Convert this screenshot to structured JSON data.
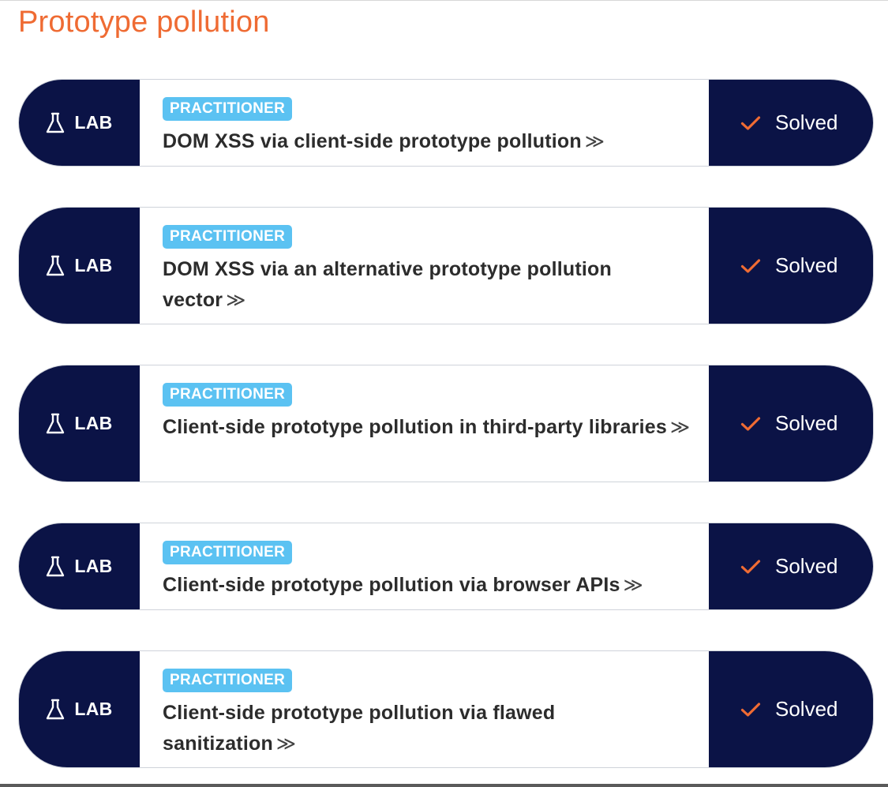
{
  "section": {
    "title": "Prototype pollution"
  },
  "colors": {
    "accent": "#ef6b33",
    "navy": "#0b1346",
    "level_blue": "#5bc2f2"
  },
  "labs": [
    {
      "type_label": "LAB",
      "type_icon": "flask-icon",
      "level": "PRACTITIONER",
      "title": "DOM XSS via client-side prototype pollution",
      "link_icon": "double-chevron-right-icon",
      "status_icon": "check-icon",
      "status": "Solved"
    },
    {
      "type_label": "LAB",
      "type_icon": "flask-icon",
      "level": "PRACTITIONER",
      "title": "DOM XSS via an alternative prototype pollution vector",
      "link_icon": "double-chevron-right-icon",
      "status_icon": "check-icon",
      "status": "Solved"
    },
    {
      "type_label": "LAB",
      "type_icon": "flask-icon",
      "level": "PRACTITIONER",
      "title": "Client-side prototype pollution in third-party libraries",
      "link_icon": "double-chevron-right-icon",
      "status_icon": "check-icon",
      "status": "Solved"
    },
    {
      "type_label": "LAB",
      "type_icon": "flask-icon",
      "level": "PRACTITIONER",
      "title": "Client-side prototype pollution via browser APIs",
      "link_icon": "double-chevron-right-icon",
      "status_icon": "check-icon",
      "status": "Solved"
    },
    {
      "type_label": "LAB",
      "type_icon": "flask-icon",
      "level": "PRACTITIONER",
      "title": "Client-side prototype pollution via flawed sanitization",
      "link_icon": "double-chevron-right-icon",
      "status_icon": "check-icon",
      "status": "Solved"
    }
  ]
}
